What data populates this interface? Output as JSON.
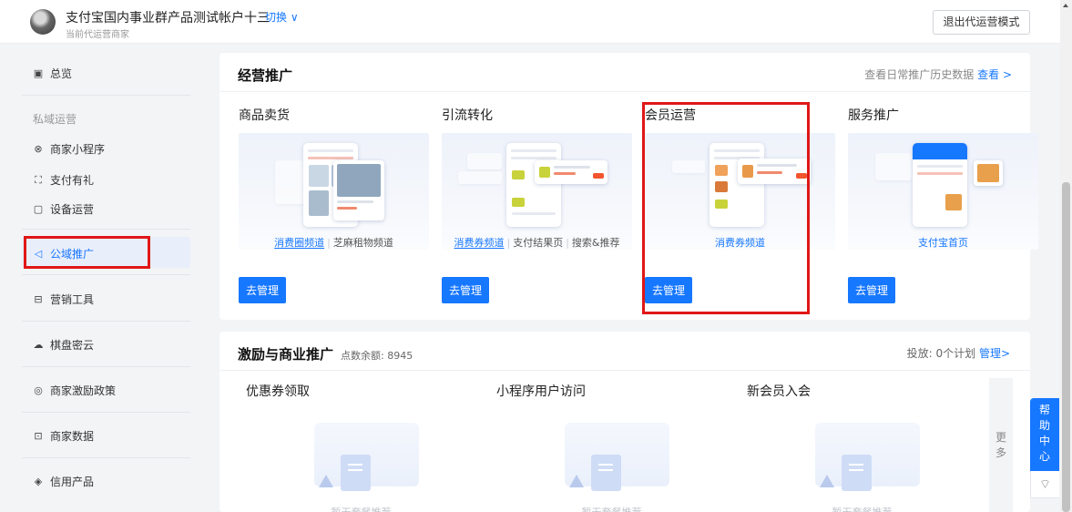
{
  "header": {
    "account_name": "支付宝国内事业群产品测试帐户十三",
    "switch_label": "切换 ∨",
    "account_sub": "当前代运营商家",
    "exit_button": "退出代运营模式"
  },
  "sidebar": {
    "items": [
      {
        "label": "总览",
        "icon": "dashboard-icon",
        "glyph": "▣"
      },
      {
        "label": "商家小程序",
        "icon": "mini-program-icon",
        "glyph": "⊗"
      },
      {
        "label": "支付有礼",
        "icon": "gift-icon",
        "glyph": "⛶"
      },
      {
        "label": "设备运营",
        "icon": "device-icon",
        "glyph": "▢"
      },
      {
        "label": "公域推广",
        "icon": "send-icon",
        "glyph": "◁",
        "active": true
      },
      {
        "label": "营销工具",
        "icon": "toolbox-icon",
        "glyph": "⊟"
      },
      {
        "label": "棋盘密云",
        "icon": "cloud-icon",
        "glyph": "☁"
      },
      {
        "label": "商家激励政策",
        "icon": "policy-icon",
        "glyph": "◎"
      },
      {
        "label": "商家数据",
        "icon": "data-icon",
        "glyph": "⊡"
      },
      {
        "label": "信用产品",
        "icon": "credit-icon",
        "glyph": "◈"
      }
    ],
    "group_label": "私域运营"
  },
  "promo": {
    "title": "经营推广",
    "history_text": "查看日常推广历史数据",
    "history_link": "查看 >",
    "columns": [
      {
        "title": "商品卖货",
        "tabs": [
          "消费圈频道",
          "芝麻租物频道"
        ],
        "button": "去管理"
      },
      {
        "title": "引流转化",
        "tabs": [
          "消费券频道",
          "支付结果页",
          "搜索&推荐"
        ],
        "button": "去管理"
      },
      {
        "title": "会员运营",
        "tabs": [
          "消费券频道"
        ],
        "button": "去管理"
      },
      {
        "title": "服务推广",
        "tabs": [
          "支付宝首页"
        ],
        "button": "去管理"
      }
    ]
  },
  "incentive": {
    "title": "激励与商业推广",
    "points_label": "点数余额: 8945",
    "plan_text": "投放: 0个计划",
    "plan_link": "管理>",
    "packages": [
      {
        "title": "优惠券领取",
        "empty": "暂无套餐推荐"
      },
      {
        "title": "小程序用户访问",
        "empty": "暂无套餐推荐"
      },
      {
        "title": "新会员入会",
        "empty": "暂无套餐推荐"
      }
    ],
    "more_label": "更多"
  },
  "help": {
    "chars": [
      "帮",
      "助",
      "中",
      "心"
    ],
    "bottom_glyph": "⌔"
  },
  "colors": {
    "accent": "#1677ff",
    "highlight_box": "#e01717"
  }
}
